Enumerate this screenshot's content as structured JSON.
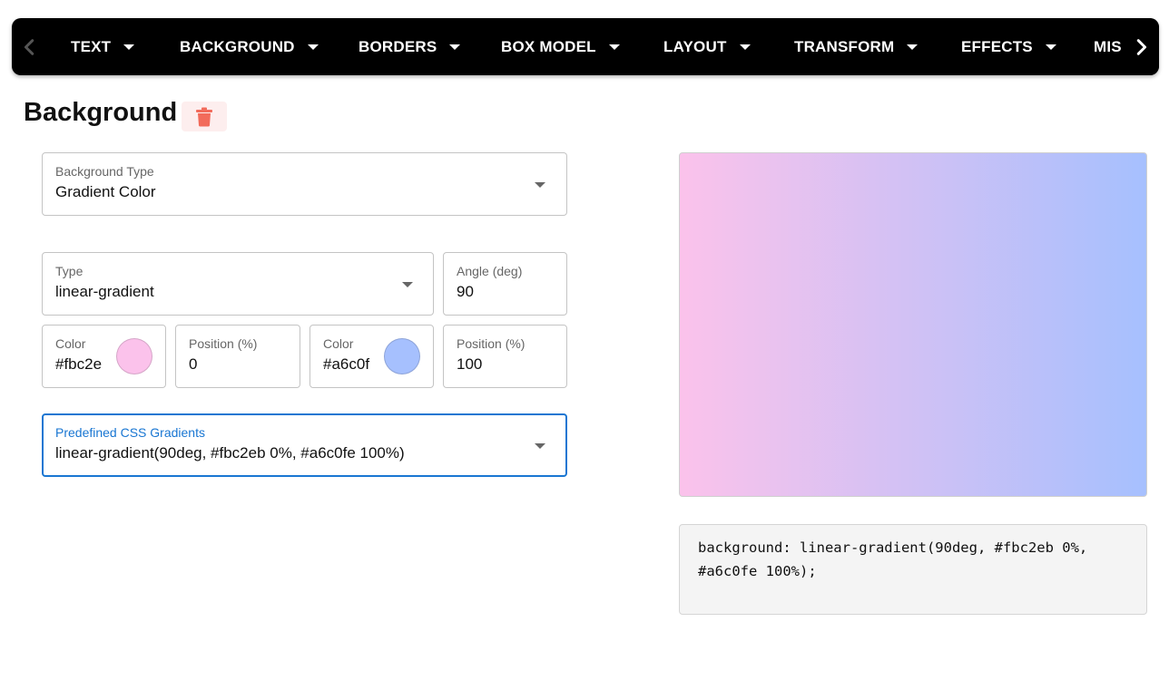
{
  "nav": {
    "tabs": [
      {
        "label": "TEXT"
      },
      {
        "label": "BACKGROUND"
      },
      {
        "label": "BORDERS"
      },
      {
        "label": "BOX MODEL"
      },
      {
        "label": "LAYOUT"
      },
      {
        "label": "TRANSFORM"
      },
      {
        "label": "EFFECTS"
      },
      {
        "label": "MIS"
      }
    ]
  },
  "header": {
    "title": "Background"
  },
  "form": {
    "background_type": {
      "label": "Background Type",
      "value": "Gradient Color"
    },
    "gradient_type": {
      "label": "Type",
      "value": "linear-gradient"
    },
    "angle": {
      "label": "Angle (deg)",
      "value": "90"
    },
    "stop1": {
      "color_label": "Color",
      "color_value": "#fbc2e",
      "color_hex": "#fbc2eb",
      "position_label": "Position (%)",
      "position_value": "0"
    },
    "stop2": {
      "color_label": "Color",
      "color_value": "#a6c0f",
      "color_hex": "#a6c0fe",
      "position_label": "Position (%)",
      "position_value": "100"
    },
    "predefined": {
      "label": "Predefined CSS Gradients",
      "value": "linear-gradient(90deg, #fbc2eb 0%, #a6c0fe 100%)"
    }
  },
  "output": {
    "code_line1": "background: linear-gradient(90deg, #fbc2eb 0%,",
    "code_line2": "#a6c0fe 100%);"
  },
  "colors": {
    "accent": "#1976d2",
    "trash": "#f26b5b",
    "navbar": "#000000"
  },
  "icons": {
    "left": "chevron-left-icon",
    "right": "chevron-right-icon",
    "trash": "trash-icon",
    "dropdown": "caret-down-icon"
  }
}
